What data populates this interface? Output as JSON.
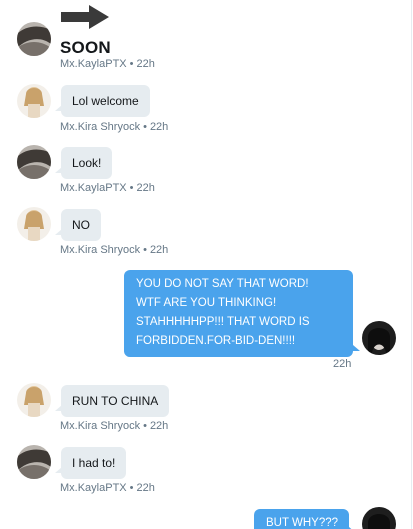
{
  "messages": [
    {
      "arrow_icon": "right-arrow-icon",
      "text": "SOON",
      "sender": "Mx.KaylaPTX",
      "time": "22h"
    },
    {
      "text": "Lol welcome",
      "sender": "Mx.Kira Shryock",
      "time": "22h"
    },
    {
      "text": "Look!",
      "sender": "Mx.KaylaPTX",
      "time": "22h"
    },
    {
      "text": "NO",
      "sender": "Mx.Kira Shryock",
      "time": "22h"
    },
    {
      "text": "YOU DO NOT SAY THAT WORD!\nWTF ARE YOU THINKING!\nSTAHHHHHPP!!! THAT WORD IS\nFORBIDDEN.FOR-BID-DEN!!!!",
      "time": "22h"
    },
    {
      "text": "RUN TO CHINA",
      "sender": "Mx.Kira Shryock",
      "time": "22h"
    },
    {
      "text": "I had to!",
      "sender": "Mx.KaylaPTX",
      "time": "22h"
    },
    {
      "text": "BUT WHY???"
    }
  ],
  "colors": {
    "incoming_bubble": "#e6ecf0",
    "outgoing_bubble": "#4aa3ec",
    "meta_text": "#657786"
  }
}
